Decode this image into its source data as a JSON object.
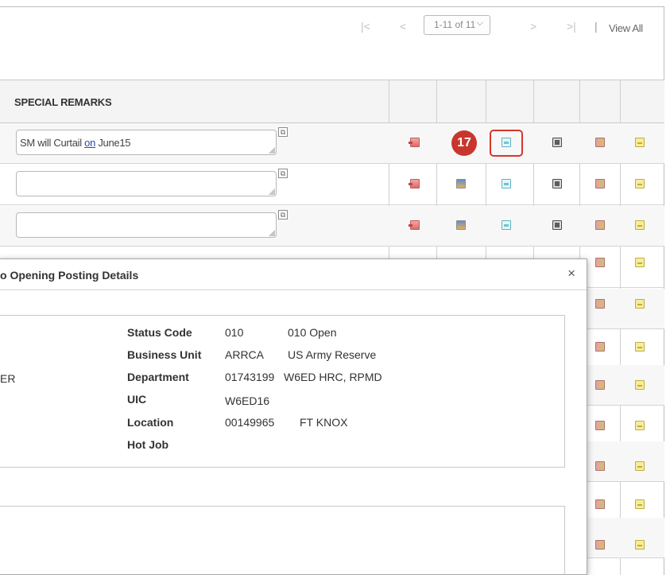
{
  "nav": {
    "first_icon": "first-page-icon",
    "prev_icon": "previous-page-icon",
    "range": "1-11 of 11",
    "next_icon": "next-page-icon",
    "last_icon": "last-page-icon",
    "separator": "|",
    "view_all": "View All"
  },
  "grid": {
    "header": "SPECIAL REMARKS",
    "rows": [
      {
        "remark_before": "SM will Curtail ",
        "remark_link": "on",
        "remark_after": " June15"
      },
      {
        "remark_before": "",
        "remark_link": "",
        "remark_after": ""
      },
      {
        "remark_before": "",
        "remark_link": "",
        "remark_after": ""
      }
    ]
  },
  "annotation": {
    "badge": "17",
    "color": "#c9362b"
  },
  "modal": {
    "title": "o Opening Posting Details",
    "close": "×",
    "left_fragment": "ER",
    "fields": [
      {
        "label": "Status Code",
        "code": "010",
        "desc": "010 Open"
      },
      {
        "label": "Business Unit",
        "code": "ARRCA",
        "desc": "US Army Reserve"
      },
      {
        "label": "Department",
        "code": "01743199",
        "desc": "W6ED HRC, RPMD"
      },
      {
        "label": "UIC",
        "code": "W6ED16",
        "desc": ""
      },
      {
        "label": "Location",
        "code": "00149965",
        "desc": "FT KNOX"
      },
      {
        "label": "Hot Job",
        "code": "",
        "desc": ""
      }
    ]
  }
}
